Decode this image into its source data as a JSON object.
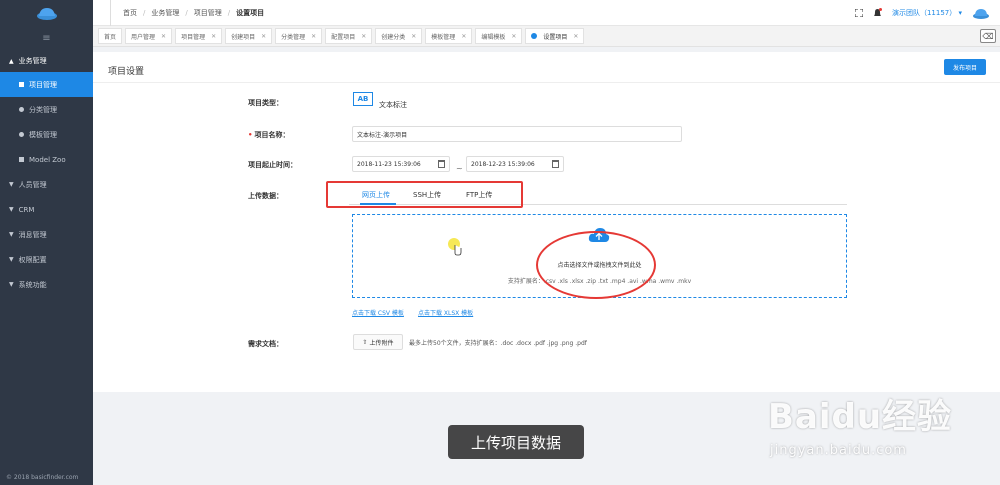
{
  "sidebar": {
    "groups": [
      {
        "label": "业务管理"
      },
      {
        "label": "人员管理"
      },
      {
        "label": "CRM"
      },
      {
        "label": "消息管理"
      },
      {
        "label": "权限配置"
      },
      {
        "label": "系统功能"
      }
    ],
    "subitems": [
      {
        "label": "项目管理"
      },
      {
        "label": "分类管理"
      },
      {
        "label": "模板管理"
      },
      {
        "label": "Model Zoo"
      }
    ],
    "copyright": "© 2018 basicfinder.com"
  },
  "header": {
    "breadcrumb": [
      "首页",
      "业务管理",
      "项目管理",
      "设置项目"
    ],
    "team": "演示团队（11157）"
  },
  "tabs": [
    {
      "label": "首页"
    },
    {
      "label": "用户管理"
    },
    {
      "label": "项目管理"
    },
    {
      "label": "创建项目"
    },
    {
      "label": "分类管理"
    },
    {
      "label": "配置项目"
    },
    {
      "label": "创建分类"
    },
    {
      "label": "模板管理"
    },
    {
      "label": "编辑模板"
    },
    {
      "label": "设置项目"
    }
  ],
  "panel": {
    "title": "项目设置",
    "publish_label": "发布项目"
  },
  "form": {
    "type_label": "项目类型：",
    "type_icon_text": "AB",
    "type_value": "文本标注",
    "name_label": "项目名称：",
    "name_value": "文本标注-演示项目",
    "time_label": "项目起止时间：",
    "start_time": "2018-11-23 15:39:06",
    "range_sep": "~",
    "end_time": "2018-12-23 15:39:06",
    "upload_label": "上传数据：",
    "upload_tabs": [
      "网页上传",
      "SSH上传",
      "FTP上传"
    ],
    "drop_hint": "点击选择文件或拖拽文件到此处",
    "ext_hint": "支持扩展名：.csv .xls .xlsx .zip .txt .mp4 .avi .wma .wmv .mkv",
    "download_csv": "点击下载 CSV 模板",
    "download_xlsx": "点击下载 XLSX 模板",
    "doc_label": "需求文档：",
    "attach_label": "上传附件",
    "attach_hint": "最多上传50个文件，支持扩展名：.doc .docx .pdf .jpg .png .pdf"
  },
  "overlay": {
    "caption": "上传项目数据",
    "watermark_main": "Baidu经验",
    "watermark_sub": "jingyan.baidu.com"
  },
  "colors": {
    "accent": "#1e88e5",
    "sidebar": "#2f3846",
    "annotation": "#e53935"
  }
}
